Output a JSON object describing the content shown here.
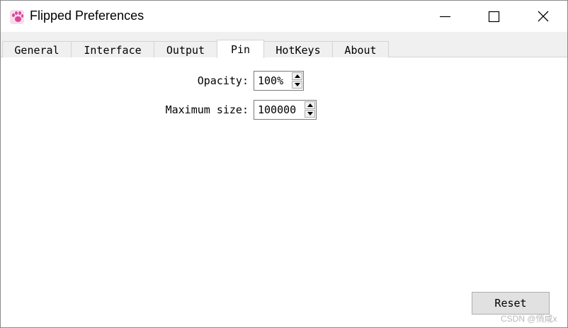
{
  "window": {
    "title": "Flipped Preferences",
    "app_icon": "paw-icon",
    "controls": {
      "minimize": "minimize-icon",
      "maximize": "maximize-icon",
      "close": "close-icon"
    }
  },
  "tabs": [
    {
      "label": "General",
      "active": false
    },
    {
      "label": "Interface",
      "active": false
    },
    {
      "label": "Output",
      "active": false
    },
    {
      "label": "Pin",
      "active": true
    },
    {
      "label": "HotKeys",
      "active": false
    },
    {
      "label": "About",
      "active": false
    }
  ],
  "pin": {
    "opacity": {
      "label": "Opacity:",
      "value": "100%"
    },
    "max_size": {
      "label": "Maximum size:",
      "value": "100000"
    }
  },
  "reset_label": "Reset",
  "watermark": "CSDN @悄咸x",
  "colors": {
    "accent_icon": "#d9479a",
    "tab_bar": "#f0f0f0",
    "button_face": "#e1e1e1"
  }
}
